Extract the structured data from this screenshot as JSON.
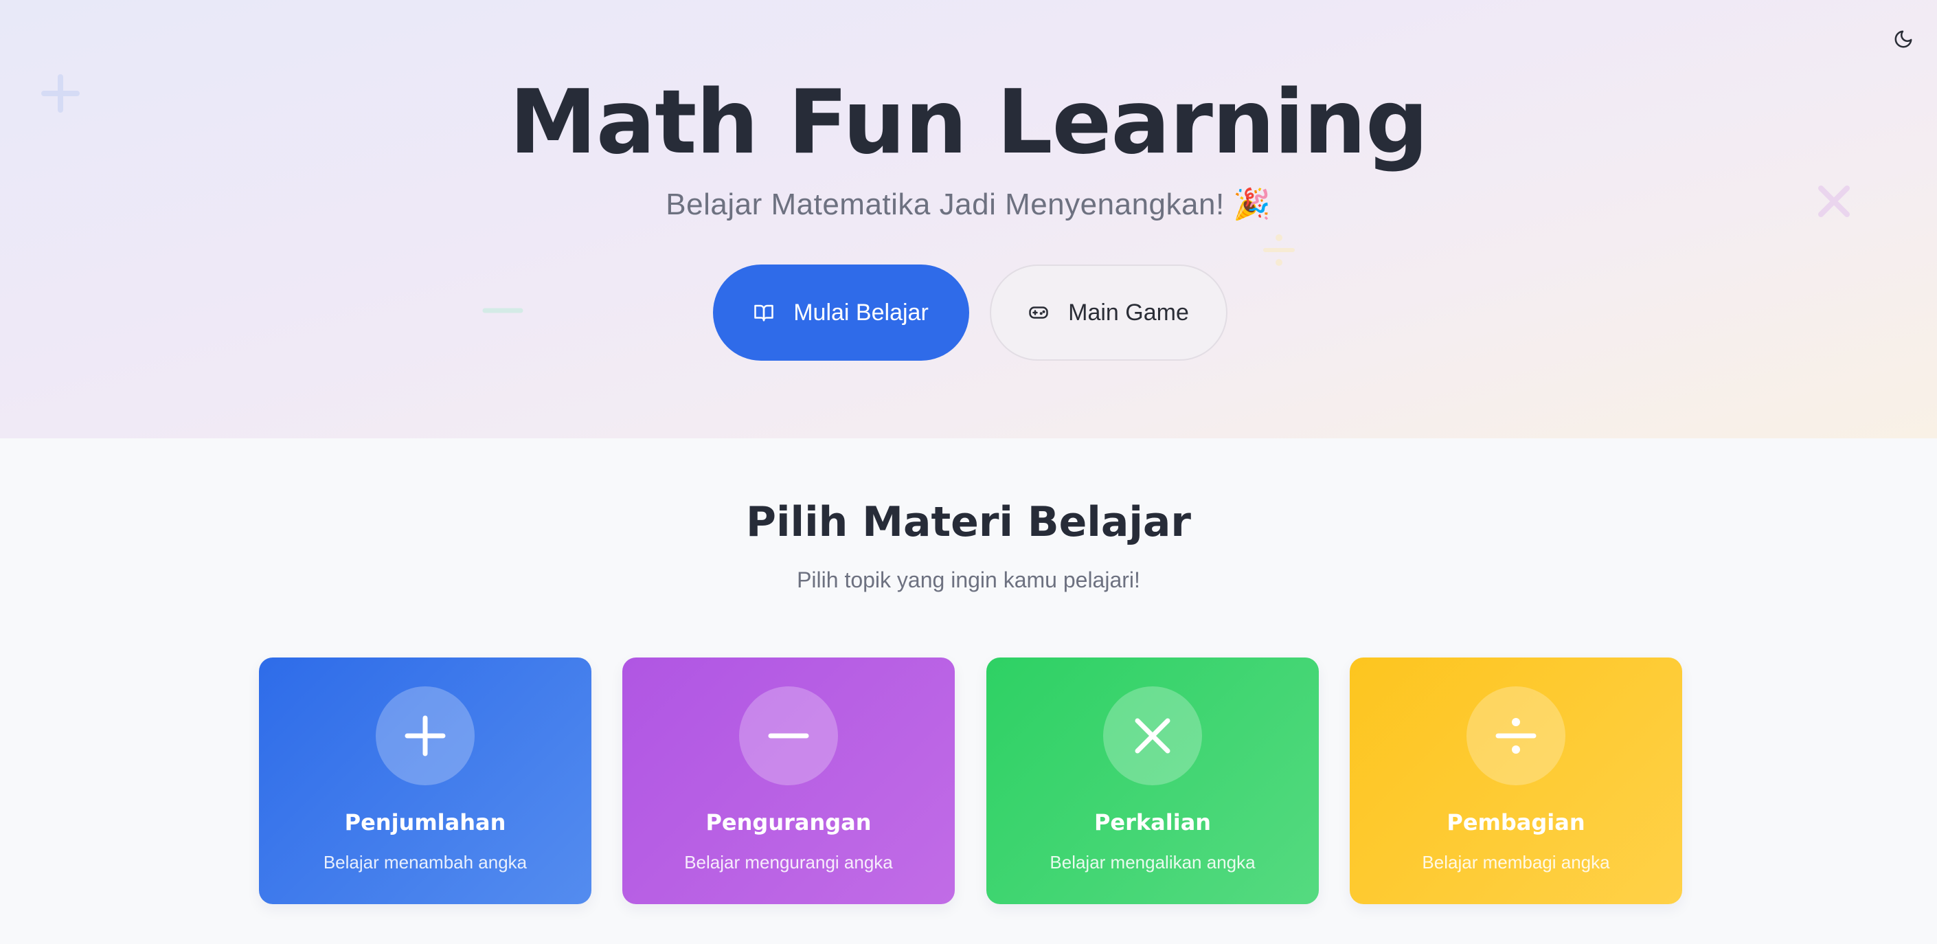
{
  "hero": {
    "title": "Math Fun Learning",
    "subtitle": "Belajar Matematika Jadi Menyenangkan! 🎉",
    "primary_button": {
      "label": "Mulai Belajar",
      "icon": "book-open-icon"
    },
    "secondary_button": {
      "label": "Main Game",
      "icon": "gamepad-icon"
    },
    "theme_toggle_icon": "moon-icon",
    "decorations": [
      "plus-symbol",
      "minus-symbol",
      "times-symbol",
      "divide-symbol"
    ]
  },
  "materials": {
    "title": "Pilih Materi Belajar",
    "subtitle": "Pilih topik yang ingin kamu pelajari!",
    "cards": [
      {
        "title": "Penjumlahan",
        "description": "Belajar menambah angka",
        "icon": "plus-icon",
        "color": "#2f6be9"
      },
      {
        "title": "Pengurangan",
        "description": "Belajar mengurangi angka",
        "icon": "minus-icon",
        "color": "#b25ae4"
      },
      {
        "title": "Perkalian",
        "description": "Belajar mengalikan angka",
        "icon": "times-icon",
        "color": "#34d367"
      },
      {
        "title": "Pembagian",
        "description": "Belajar membagi angka",
        "icon": "divide-icon",
        "color": "#fec727"
      }
    ]
  },
  "colors": {
    "primary": "#2f6be9",
    "heading": "#272c38",
    "muted": "#6d7180"
  }
}
